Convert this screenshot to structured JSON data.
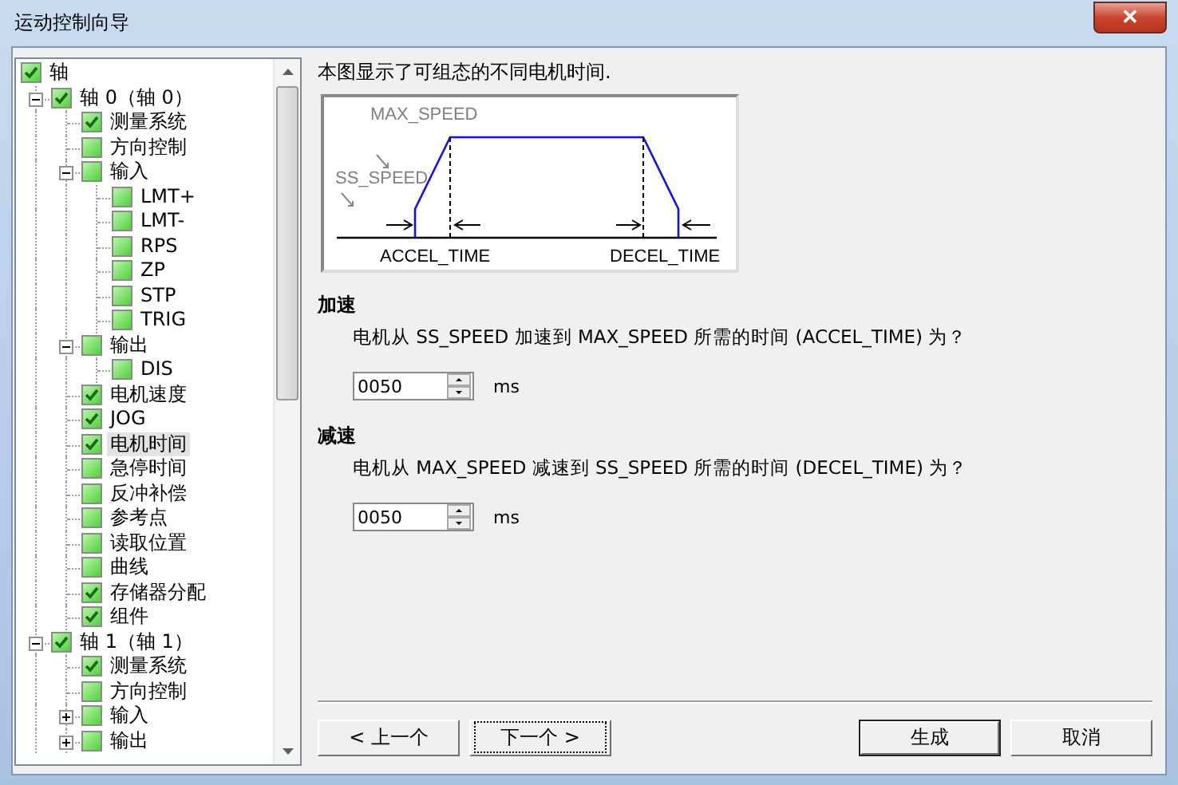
{
  "window": {
    "title": "运动控制向导",
    "close_label": "✕"
  },
  "tree": [
    {
      "label": "轴",
      "checked": true,
      "selected": false,
      "children": [
        {
          "label": "轴 0（轴 0）",
          "checked": true,
          "selected": false,
          "expanded": true,
          "children": [
            {
              "label": "测量系统",
              "checked": true,
              "selected": false
            },
            {
              "label": "方向控制",
              "checked": false,
              "selected": false
            },
            {
              "label": "输入",
              "checked": false,
              "selected": false,
              "expanded": true,
              "children": [
                {
                  "label": "LMT+",
                  "checked": false,
                  "selected": false
                },
                {
                  "label": "LMT-",
                  "checked": false,
                  "selected": false
                },
                {
                  "label": "RPS",
                  "checked": false,
                  "selected": false
                },
                {
                  "label": "ZP",
                  "checked": false,
                  "selected": false
                },
                {
                  "label": "STP",
                  "checked": false,
                  "selected": false
                },
                {
                  "label": "TRIG",
                  "checked": false,
                  "selected": false
                }
              ]
            },
            {
              "label": "输出",
              "checked": false,
              "selected": false,
              "expanded": true,
              "children": [
                {
                  "label": "DIS",
                  "checked": false,
                  "selected": false
                }
              ]
            },
            {
              "label": "电机速度",
              "checked": true,
              "selected": false
            },
            {
              "label": "JOG",
              "checked": true,
              "selected": false
            },
            {
              "label": "电机时间",
              "checked": true,
              "selected": true
            },
            {
              "label": "急停时间",
              "checked": false,
              "selected": false
            },
            {
              "label": "反冲补偿",
              "checked": false,
              "selected": false
            },
            {
              "label": "参考点",
              "checked": false,
              "selected": false
            },
            {
              "label": "读取位置",
              "checked": false,
              "selected": false
            },
            {
              "label": "曲线",
              "checked": false,
              "selected": false
            },
            {
              "label": "存储器分配",
              "checked": true,
              "selected": false
            },
            {
              "label": "组件",
              "checked": true,
              "selected": false
            }
          ]
        },
        {
          "label": "轴 1（轴 1）",
          "checked": true,
          "selected": false,
          "expanded": true,
          "children": [
            {
              "label": "测量系统",
              "checked": true,
              "selected": false
            },
            {
              "label": "方向控制",
              "checked": false,
              "selected": false
            },
            {
              "label": "输入",
              "checked": false,
              "selected": false,
              "expanded": false
            },
            {
              "label": "输出",
              "checked": false,
              "selected": false,
              "expanded": false
            }
          ]
        }
      ]
    }
  ],
  "description": "本图显示了可组态的不同电机时间.",
  "diagram": {
    "max_speed_label": "MAX_SPEED",
    "ss_speed_label": "SS_SPEED",
    "accel_time_label": "ACCEL_TIME",
    "decel_time_label": "DECEL_TIME"
  },
  "sections": [
    {
      "heading": "加速",
      "question": "电机从 SS_SPEED 加速到 MAX_SPEED 所需的时间 (ACCEL_TIME) 为？",
      "value": "0050",
      "unit": "ms"
    },
    {
      "heading": "减速",
      "question": "电机从 MAX_SPEED 减速到 SS_SPEED 所需的时间 (DECEL_TIME) 为？",
      "value": "0050",
      "unit": "ms"
    }
  ],
  "buttons": [
    {
      "label": "< 上一个",
      "kind": "nav",
      "focused": false
    },
    {
      "label": "下一个 >",
      "kind": "nav",
      "focused": true
    },
    {
      "label": "生成",
      "kind": "default",
      "focused": false
    },
    {
      "label": "取消",
      "kind": "plain",
      "focused": false
    }
  ]
}
